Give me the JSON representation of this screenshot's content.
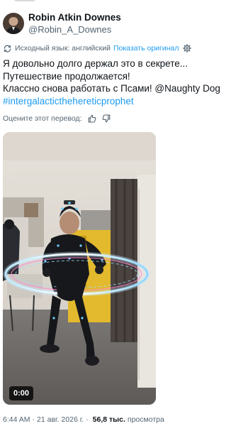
{
  "author": {
    "display_name": "Robin Atkin Downes",
    "handle": "@Robin_A_Downes"
  },
  "translation": {
    "source_language_label": "Исходный язык: английский",
    "show_original_link": "Показать оригинал",
    "rate_prompt": "Оцените этот перевод:"
  },
  "tweet": {
    "lines": [
      "Я довольно долго держал это в секрете...",
      "Путешествие продолжается!",
      "Классно снова работать с Псами! @Naughty Dog"
    ],
    "hashtag": "#intergalacticthehereticprophet"
  },
  "media": {
    "duration": "0:00"
  },
  "meta": {
    "time": "6:44 AM",
    "separator": "·",
    "date": "21 авг. 2026 г.",
    "views_count": "56,8 тыс.",
    "views_label": "просмотра"
  },
  "icons": {
    "translate": "translate-icon",
    "settings": "gear-icon",
    "like": "thumbs-up-icon",
    "dislike": "thumbs-down-icon"
  },
  "colors": {
    "link": "#1d9bf0",
    "text": "#0f1419",
    "secondary": "#536471"
  }
}
